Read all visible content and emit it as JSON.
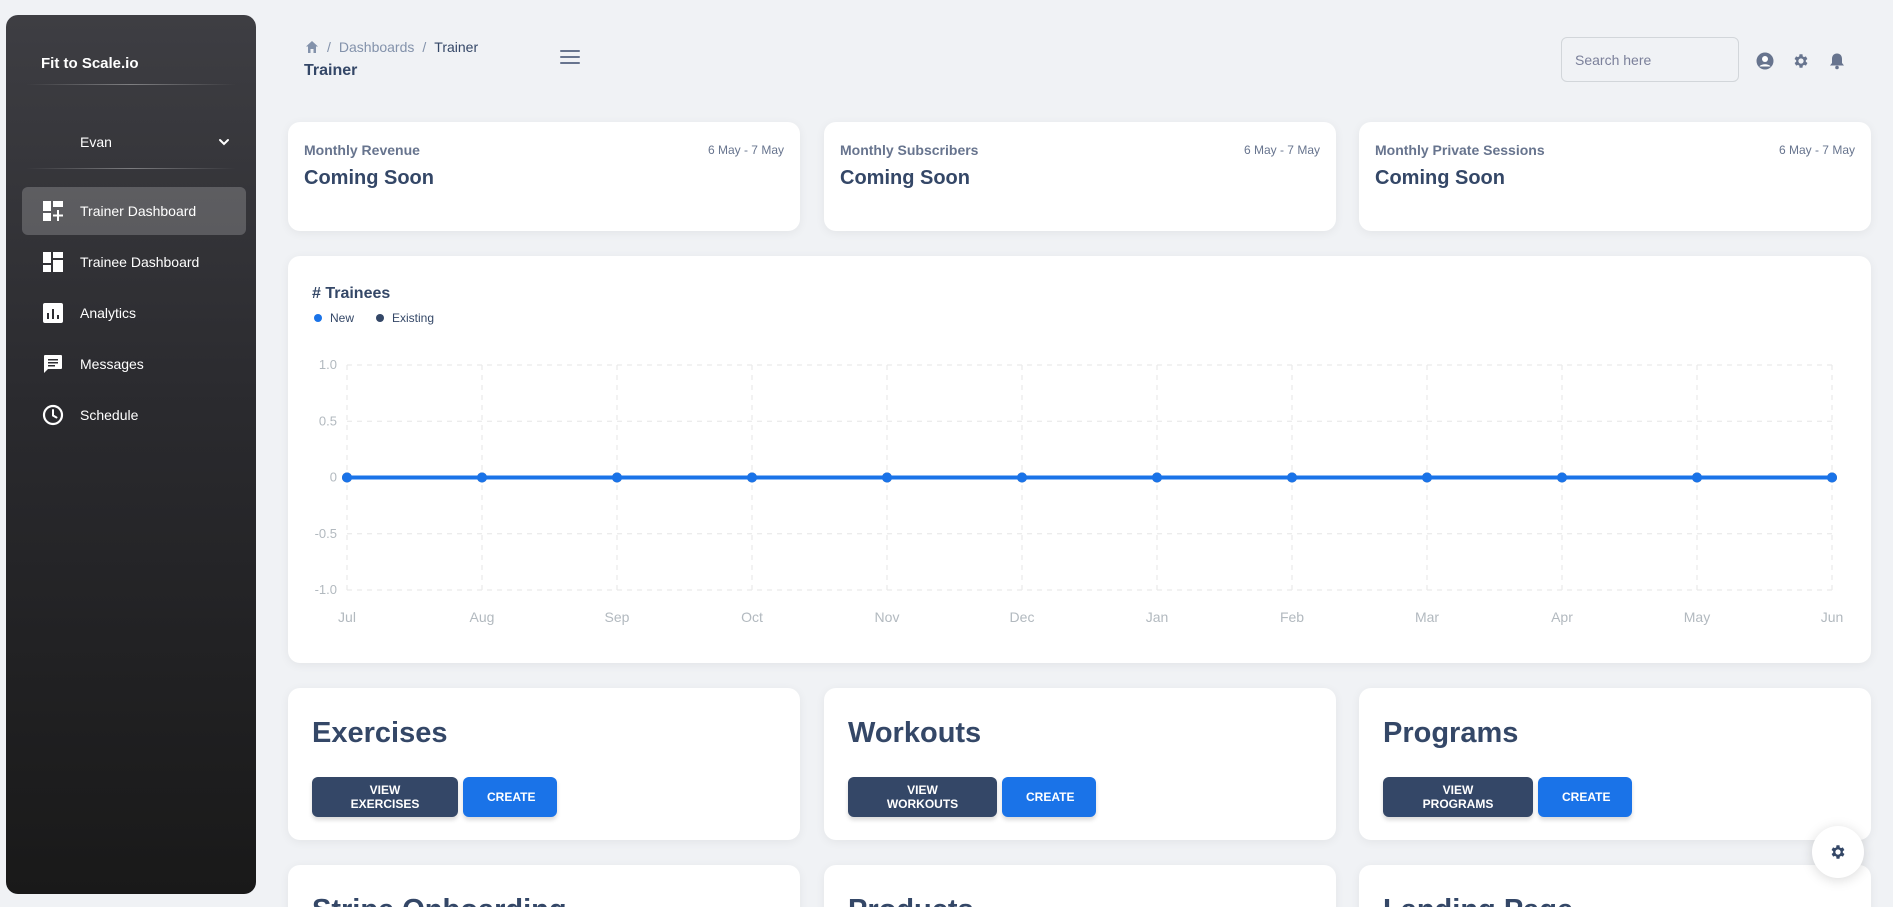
{
  "sidebar": {
    "brand": "Fit to Scale.io",
    "user": "Evan",
    "items": [
      {
        "label": "Trainer Dashboard",
        "icon": "dashboard-add-icon"
      },
      {
        "label": "Trainee Dashboard",
        "icon": "dashboard-icon"
      },
      {
        "label": "Analytics",
        "icon": "analytics-icon"
      },
      {
        "label": "Messages",
        "icon": "chat-icon"
      },
      {
        "label": "Schedule",
        "icon": "clock-icon"
      }
    ]
  },
  "header": {
    "breadcrumb": [
      "Dashboards",
      "Trainer"
    ],
    "title": "Trainer",
    "search_placeholder": "Search here"
  },
  "stats": [
    {
      "label": "Monthly Revenue",
      "date": "6 May - 7 May",
      "value": "Coming Soon"
    },
    {
      "label": "Monthly Subscribers",
      "date": "6 May - 7 May",
      "value": "Coming Soon"
    },
    {
      "label": "Monthly Private Sessions",
      "date": "6 May - 7 May",
      "value": "Coming Soon"
    }
  ],
  "chart_data": {
    "type": "line",
    "title": "# Trainees",
    "categories": [
      "Jul",
      "Aug",
      "Sep",
      "Oct",
      "Nov",
      "Dec",
      "Jan",
      "Feb",
      "Mar",
      "Apr",
      "May",
      "Jun"
    ],
    "series": [
      {
        "name": "New",
        "color": "#1a73e8",
        "values": [
          0,
          0,
          0,
          0,
          0,
          0,
          0,
          0,
          0,
          0,
          0,
          0
        ]
      },
      {
        "name": "Existing",
        "color": "#344767",
        "values": [
          0,
          0,
          0,
          0,
          0,
          0,
          0,
          0,
          0,
          0,
          0,
          0
        ]
      }
    ],
    "yticks": [
      "1.0",
      "0.5",
      "0",
      "-0.5",
      "-1.0"
    ],
    "ylim": [
      -1,
      1
    ],
    "grid": true,
    "legend": "top-left"
  },
  "features": [
    {
      "title": "Exercises",
      "view_label": "VIEW EXERCISES",
      "create_label": "CREATE"
    },
    {
      "title": "Workouts",
      "view_label": "VIEW WORKOUTS",
      "create_label": "CREATE"
    },
    {
      "title": "Programs",
      "view_label": "VIEW PROGRAMS",
      "create_label": "CREATE"
    }
  ],
  "lower_cards": [
    {
      "title": "Stripe Onboarding"
    },
    {
      "title": "Products"
    },
    {
      "title": "Landing Page"
    }
  ],
  "colors": {
    "primary": "#1a73e8",
    "dark": "#344767",
    "background": "#f0f2f5"
  }
}
